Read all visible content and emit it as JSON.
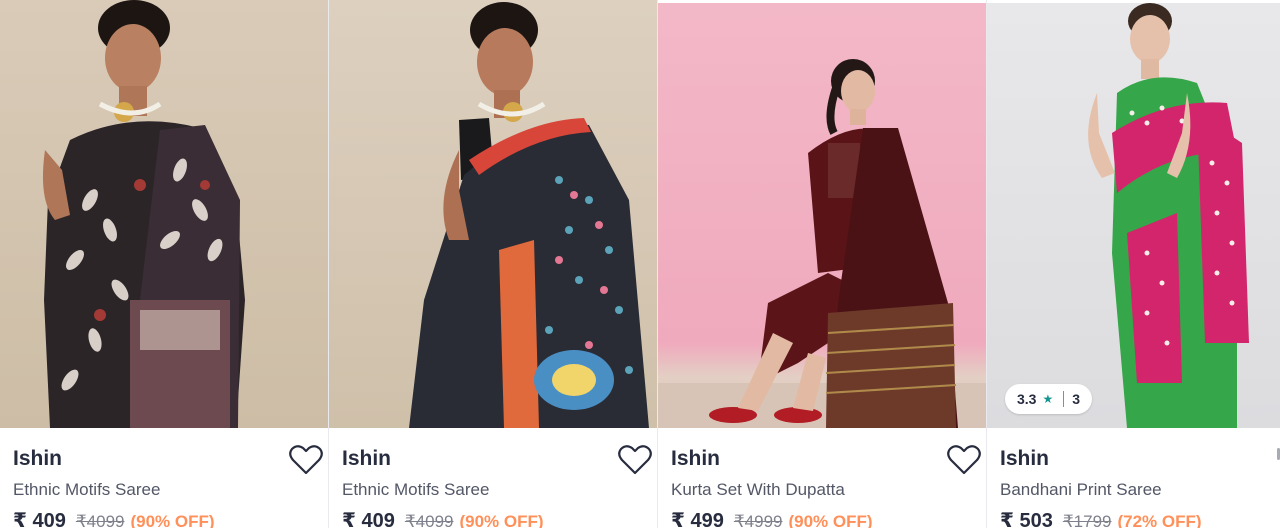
{
  "currency_symbol": "₹",
  "products": [
    {
      "brand": "Ishin",
      "title": "Ethnic Motifs Saree",
      "price": "₹ 409",
      "mrp": "₹4099",
      "discount": "(90% OFF)",
      "wishlist_icon": "heart-outline-icon"
    },
    {
      "brand": "Ishin",
      "title": "Ethnic Motifs Saree",
      "price": "₹ 409",
      "mrp": "₹4099",
      "discount": "(90% OFF)",
      "wishlist_icon": "heart-outline-icon"
    },
    {
      "brand": "Ishin",
      "title": "Kurta Set With Dupatta",
      "price": "₹ 499",
      "mrp": "₹4999",
      "discount": "(90% OFF)",
      "wishlist_icon": "heart-outline-icon"
    },
    {
      "brand": "Ishin",
      "title": "Bandhani Print Saree",
      "price": "₹ 503",
      "mrp": "₹1799",
      "discount": "(72% OFF)",
      "rating": "3.3",
      "rating_count": "3",
      "rating_icon": "star-icon"
    }
  ],
  "colors": {
    "brand_text": "#282c3f",
    "title_text": "#535766",
    "mrp_text": "#7e818c",
    "discount": "#ff905a",
    "rating_star": "#14958f"
  }
}
